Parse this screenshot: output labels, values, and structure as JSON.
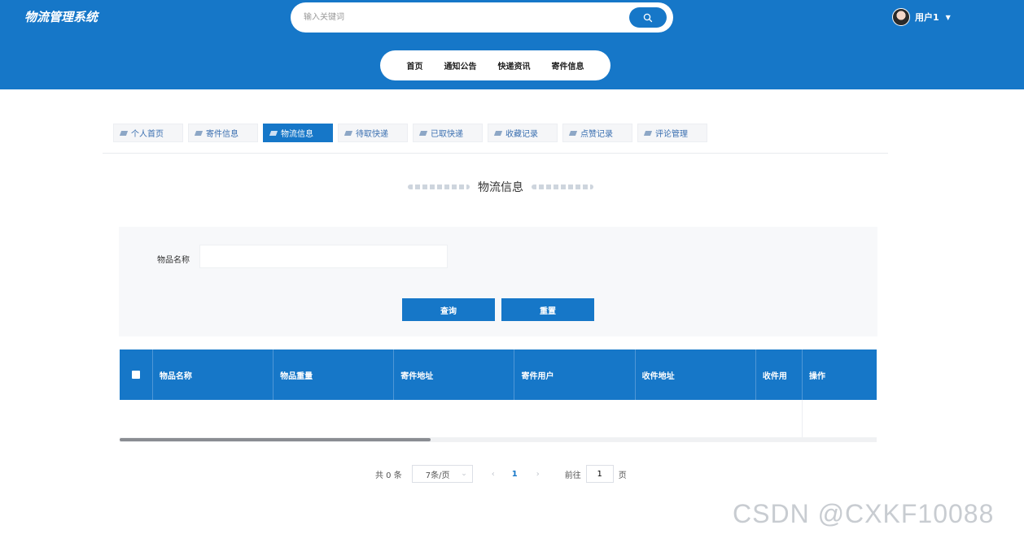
{
  "header": {
    "logo": "物流管理系统",
    "search_placeholder": "输入关键词",
    "user_name": "用户1",
    "nav": [
      "首页",
      "通知公告",
      "快递资讯",
      "寄件信息"
    ],
    "accent_color": "#1677c8"
  },
  "tabs": [
    {
      "label": "个人首页",
      "active": false
    },
    {
      "label": "寄件信息",
      "active": false
    },
    {
      "label": "物流信息",
      "active": true
    },
    {
      "label": "待取快递",
      "active": false
    },
    {
      "label": "已取快递",
      "active": false
    },
    {
      "label": "收藏记录",
      "active": false
    },
    {
      "label": "点赞记录",
      "active": false
    },
    {
      "label": "评论管理",
      "active": false
    }
  ],
  "page_title": "物流信息",
  "filter": {
    "label": "物品名称",
    "value": "",
    "query_label": "查询",
    "reset_label": "重置"
  },
  "table": {
    "columns": [
      "物品名称",
      "物品重量",
      "寄件地址",
      "寄件用户",
      "收件地址",
      "收件用"
    ],
    "op_column": "操作",
    "rows": []
  },
  "pagination": {
    "total": "共 0 条",
    "page_size": "7条/页",
    "current": "1",
    "goto_prefix": "前往",
    "goto_value": "1",
    "goto_suffix": "页"
  },
  "watermark": "CSDN @CXKF10088"
}
